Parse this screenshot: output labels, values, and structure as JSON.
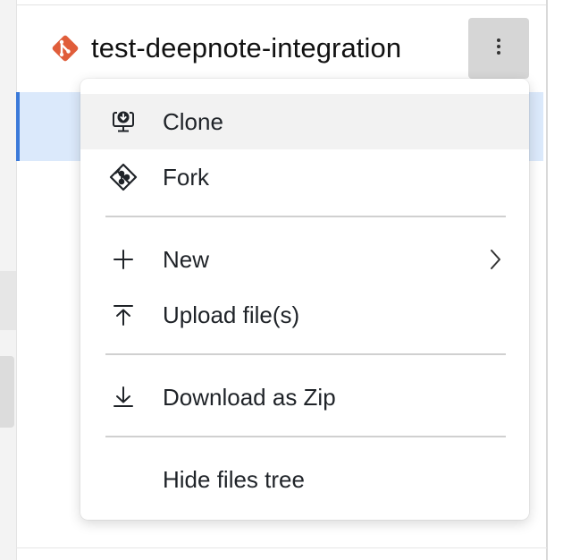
{
  "header": {
    "title": "test-deepnote-integration",
    "icon": "git-icon",
    "icon_color": "#e05d3a",
    "more_button_icon": "kebab-vertical-icon"
  },
  "menu": {
    "items": [
      {
        "label": "Clone",
        "icon": "clone-download-icon",
        "highlighted": true
      },
      {
        "label": "Fork",
        "icon": "fork-icon"
      },
      {
        "label": "New",
        "icon": "plus-icon",
        "has_submenu": true
      },
      {
        "label": "Upload file(s)",
        "icon": "upload-icon"
      },
      {
        "label": "Download as Zip",
        "icon": "download-icon"
      },
      {
        "label": "Hide files tree",
        "icon": ""
      }
    ]
  },
  "colors": {
    "selected_row_bg": "#dbe9fb",
    "selected_row_accent": "#3b7ad9",
    "more_button_bg": "#d6d6d6",
    "menu_hover_bg": "#f2f2f2"
  }
}
